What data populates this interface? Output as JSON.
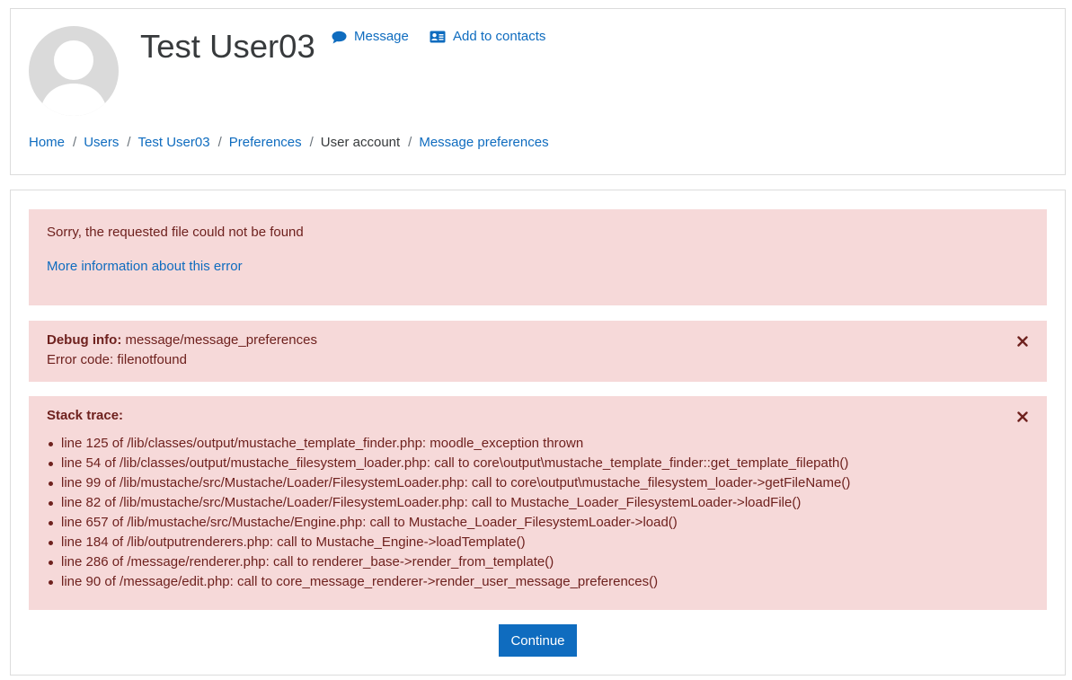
{
  "profile": {
    "name": "Test User03",
    "message_label": "Message",
    "add_contacts_label": "Add to contacts"
  },
  "breadcrumb": {
    "home": "Home",
    "users": "Users",
    "user": "Test User03",
    "preferences": "Preferences",
    "user_account": "User account",
    "message_preferences": "Message preferences",
    "separator": "/"
  },
  "error": {
    "message": "Sorry, the requested file could not be found",
    "more_info_link": "More information about this error"
  },
  "debug": {
    "label": "Debug info:",
    "value": "message/message_preferences",
    "error_code": "Error code: filenotfound"
  },
  "stack_trace": {
    "label": "Stack trace:",
    "lines": [
      "line 125 of /lib/classes/output/mustache_template_finder.php: moodle_exception thrown",
      "line 54 of /lib/classes/output/mustache_filesystem_loader.php: call to core\\output\\mustache_template_finder::get_template_filepath()",
      "line 99 of /lib/mustache/src/Mustache/Loader/FilesystemLoader.php: call to core\\output\\mustache_filesystem_loader->getFileName()",
      "line 82 of /lib/mustache/src/Mustache/Loader/FilesystemLoader.php: call to Mustache_Loader_FilesystemLoader->loadFile()",
      "line 657 of /lib/mustache/src/Mustache/Engine.php: call to Mustache_Loader_FilesystemLoader->load()",
      "line 184 of /lib/outputrenderers.php: call to Mustache_Engine->loadTemplate()",
      "line 286 of /message/renderer.php: call to renderer_base->render_from_template()",
      "line 90 of /message/edit.php: call to core_message_renderer->render_user_message_preferences()"
    ]
  },
  "continue_label": "Continue",
  "colors": {
    "link": "#0f6cbf",
    "alert_bg": "#f6d9d9",
    "alert_text": "#6e211e",
    "primary_button": "#0f6cbf"
  },
  "icons": {
    "message": "comment-icon",
    "contacts": "address-card-icon",
    "close": "close-icon",
    "avatar": "default-user-avatar"
  }
}
